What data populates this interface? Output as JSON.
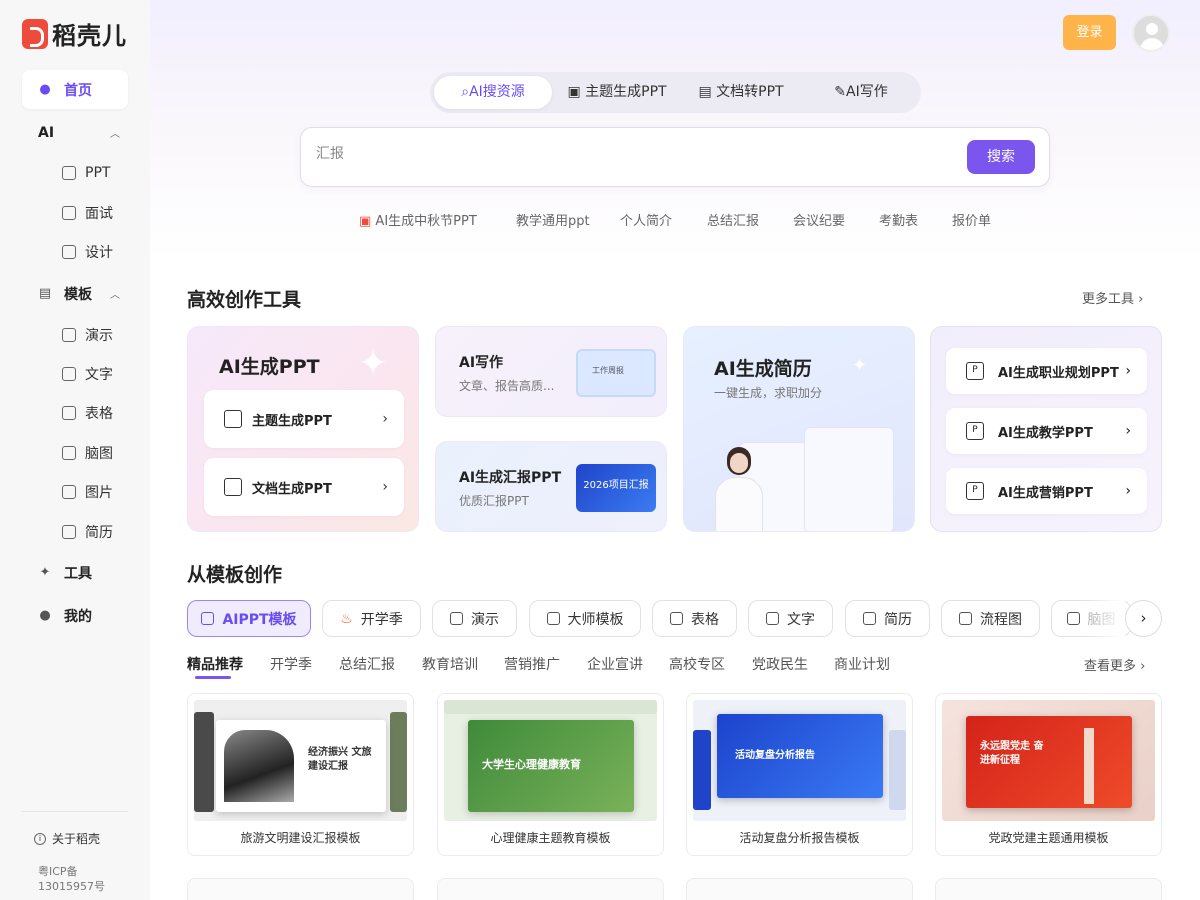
{
  "brand": {
    "name": "稻壳儿"
  },
  "sidebar": {
    "home": "首页",
    "ai_group": "AI",
    "ai_items": [
      "PPT",
      "面试",
      "设计"
    ],
    "template_group": "模板",
    "template_items": [
      "演示",
      "文字",
      "表格",
      "脑图",
      "图片",
      "简历"
    ],
    "tools": "工具",
    "mine": "我的",
    "about": "关于稻壳",
    "icp": "粤ICP备13015957号"
  },
  "header": {
    "login": "登录"
  },
  "search": {
    "tabs": [
      "AI搜资源",
      "主题生成PPT",
      "文档转PPT",
      "AI写作"
    ],
    "value": "",
    "placeholder": "汇报",
    "button": "搜索",
    "hot": [
      "AI生成中秋节PPT",
      "教学通用ppt",
      "个人简介",
      "总结汇报",
      "会议纪要",
      "考勤表",
      "报价单"
    ]
  },
  "tools_section": {
    "title": "高效创作工具",
    "more": "更多工具",
    "card_ppt": {
      "title": "AI生成PPT",
      "btn1": "主题生成PPT",
      "btn2": "文档生成PPT"
    },
    "card_write": {
      "title": "AI写作",
      "sub": "文章、报告高质...",
      "thumb": "工作周报"
    },
    "card_report": {
      "title": "AI生成汇报PPT",
      "sub": "优质汇报PPT",
      "thumb": "2026项目汇报"
    },
    "card_resume": {
      "title": "AI生成简历",
      "sub": "一键生成，求职加分"
    },
    "card_list": [
      "AI生成职业规划PPT",
      "AI生成教学PPT",
      "AI生成营销PPT"
    ]
  },
  "template_section": {
    "title": "从模板创作",
    "categories": [
      "AIPPT模板",
      "开学季",
      "演示",
      "大师模板",
      "表格",
      "文字",
      "简历",
      "流程图",
      "脑图"
    ],
    "filters": [
      "精品推荐",
      "开学季",
      "总结汇报",
      "教育培训",
      "营销推广",
      "企业宣讲",
      "高校专区",
      "党政民生",
      "商业计划"
    ],
    "more": "查看更多",
    "items": [
      {
        "caption": "旅游文明建设汇报模板",
        "slide": "经济振兴 文旅建设汇报"
      },
      {
        "caption": "心理健康主题教育模板",
        "slide": "大学生心理健康教育"
      },
      {
        "caption": "活动复盘分析报告模板",
        "slide": "活动复盘分析报告"
      },
      {
        "caption": "党政党建主题通用模板",
        "slide": "永远跟党走 奋进新征程"
      }
    ]
  },
  "colors": {
    "accent": "#7b56ee",
    "login": "#ffb44a",
    "brand": "#ef4b3c"
  }
}
